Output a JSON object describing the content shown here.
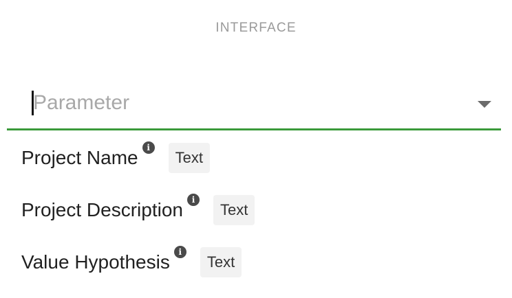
{
  "section": {
    "heading": "INTERFACE"
  },
  "parameter_select": {
    "placeholder": "Parameter",
    "value": "",
    "accent_color": "#3a9a3a",
    "icon": "chevron-down-icon"
  },
  "parameters": [
    {
      "label": "Project Name",
      "type": "Text",
      "info_icon": "info-icon"
    },
    {
      "label": "Project Description",
      "type": "Text",
      "info_icon": "info-icon"
    },
    {
      "label": "Value Hypothesis",
      "type": "Text",
      "info_icon": "info-icon"
    }
  ]
}
